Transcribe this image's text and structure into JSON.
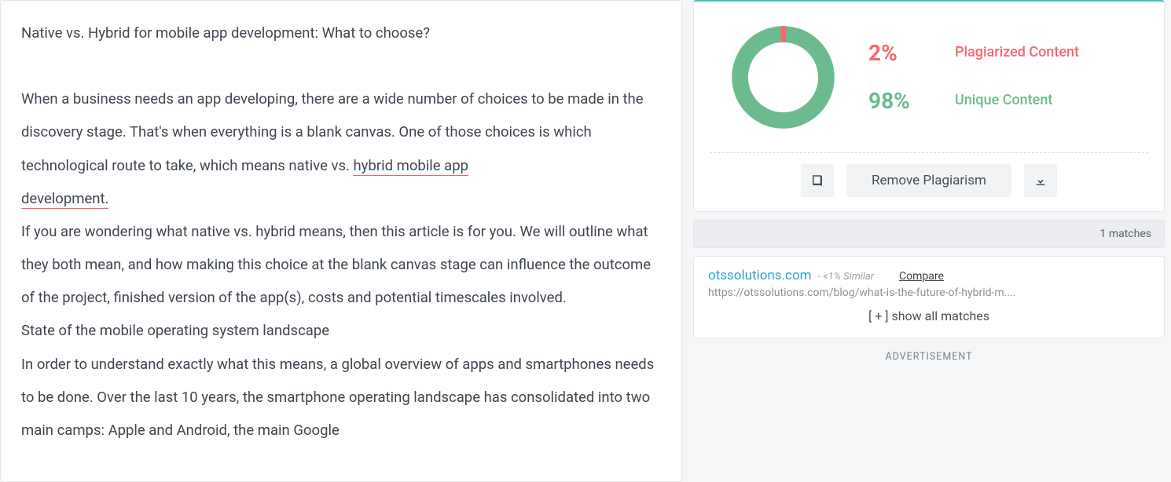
{
  "content": {
    "title": "Native vs. Hybrid for mobile app development: What to choose?",
    "p1_before": "When a business needs an app developing, there are a wide number of choices to be made in the discovery stage. That's when everything is a blank canvas. One of those choices is which technological route to take, which means native vs. ",
    "p1_under1": "hybrid mobile app",
    "p1_under2": "development.",
    "p2": "If you are wondering what native vs. hybrid means, then this article is for you. We will outline what they both mean, and how making this choice at the blank canvas stage can influence the outcome of the project, finished version of the app(s), costs and potential timescales involved.",
    "p3": "State of the mobile operating system landscape",
    "p4": "In order to understand exactly what this means, a global overview of apps and smartphones needs to be done. Over the last 10 years, the smartphone operating landscape has consolidated into two main camps: Apple and Android, the main Google"
  },
  "chart_data": {
    "type": "pie",
    "title": "",
    "series": [
      {
        "name": "Plagiarized Content",
        "value": 2,
        "color": "#f06a6f"
      },
      {
        "name": "Unique Content",
        "value": 98,
        "color": "#6cbb8f"
      }
    ]
  },
  "stats": {
    "plag_pct": "2%",
    "plag_label": "Plagiarized Content",
    "uniq_pct": "98%",
    "uniq_label": "Unique Content"
  },
  "actions": {
    "remove_label": "Remove Plagiarism"
  },
  "matches": {
    "count_label": "1 matches",
    "item": {
      "domain": "otssolutions.com",
      "similar": "- <1% Similar",
      "compare": "Compare",
      "url": "https://otssolutions.com/blog/what-is-the-future-of-hybrid-m...."
    },
    "show_all": "[ + ] show all matches"
  },
  "ad_label": "ADVERTISEMENT"
}
